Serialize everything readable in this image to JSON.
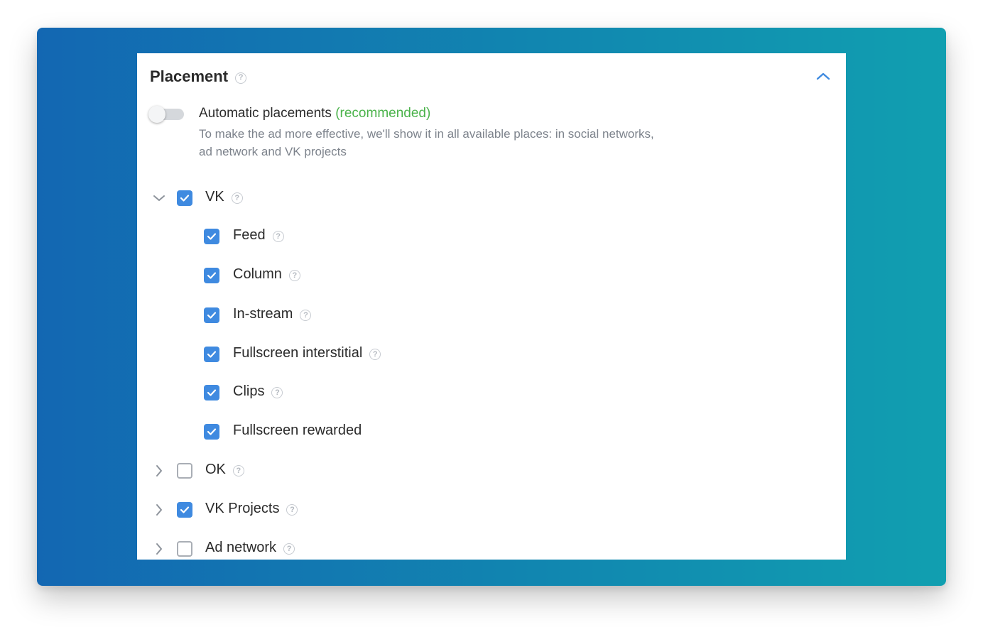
{
  "section": {
    "title": "Placement",
    "collapse_icon": "chevron-up-icon"
  },
  "automatic": {
    "label": "Automatic placements",
    "recommended": "(recommended)",
    "description_line1": "To make the ad more effective, we'll show it in all available places: in social networks,",
    "description_line2": "ad network and VK projects",
    "enabled": false
  },
  "groups": [
    {
      "label": "VK",
      "checked": true,
      "expanded": true,
      "children": [
        {
          "label": "Feed",
          "checked": true,
          "help": true
        },
        {
          "label": "Column",
          "checked": true,
          "help": true
        },
        {
          "label": "In-stream",
          "checked": true,
          "help": true
        },
        {
          "label": "Fullscreen interstitial",
          "checked": true,
          "help": true
        },
        {
          "label": "Clips",
          "checked": true,
          "help": true
        },
        {
          "label": "Fullscreen rewarded",
          "checked": true,
          "help": false
        }
      ]
    },
    {
      "label": "OK",
      "checked": false,
      "expanded": false
    },
    {
      "label": "VK Projects",
      "checked": true,
      "expanded": false
    },
    {
      "label": "Ad network",
      "checked": false,
      "expanded": false
    }
  ],
  "help_glyph": "?",
  "colors": {
    "accent": "#3f8ae0",
    "recommended": "#4bb34b",
    "background_gradient_start": "#1367b2",
    "background_gradient_end": "#119fb0"
  }
}
